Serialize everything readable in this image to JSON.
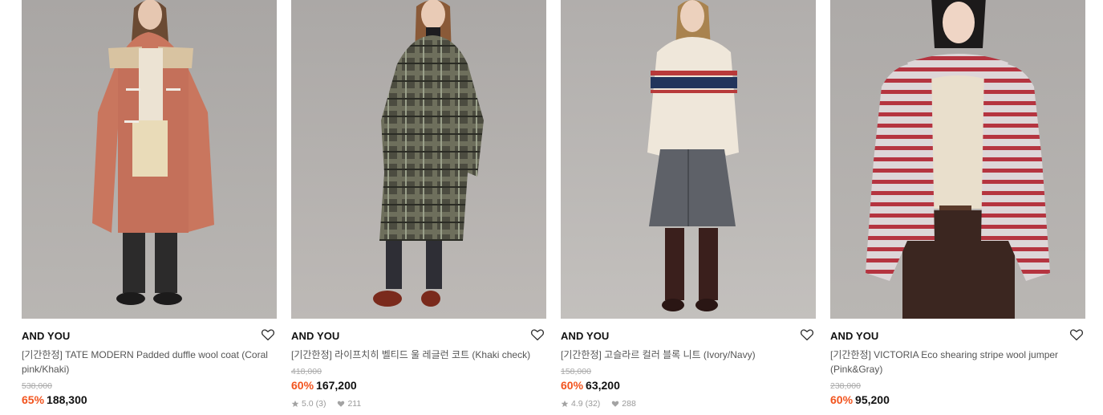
{
  "products": [
    {
      "brand": "AND YOU",
      "title": "[기간한정] TATE MODERN Padded duffle wool coat (Coral pink/Khaki)",
      "original_price": "538,000",
      "discount": "65%",
      "price": "188,300",
      "rating": "",
      "reviews": "",
      "likes": ""
    },
    {
      "brand": "AND YOU",
      "title": "[기간한정] 라이프치히 벨티드 울 레글런 코트 (Khaki check)",
      "original_price": "418,000",
      "discount": "60%",
      "price": "167,200",
      "rating": "5.0",
      "reviews": "(3)",
      "likes": "211"
    },
    {
      "brand": "AND YOU",
      "title": "[기간한정] 고슬라르 컬러 블록 니트 (Ivory/Navy)",
      "original_price": "158,000",
      "discount": "60%",
      "price": "63,200",
      "rating": "4.9",
      "reviews": "(32)",
      "likes": "288"
    },
    {
      "brand": "AND YOU",
      "title": "[기간한정] VICTORIA Eco shearing stripe wool jumper (Pink&Gray)",
      "original_price": "238,000",
      "discount": "60%",
      "price": "95,200",
      "rating": "",
      "reviews": "",
      "likes": ""
    }
  ],
  "colors": {
    "discount": "#f2541e",
    "price": "#111111",
    "brand": "#111111",
    "title": "#555555",
    "original_price": "#aaaaaa",
    "meta": "#999999",
    "photo_background": "#b7b3b0"
  },
  "icons": {
    "wishlist": "heart-outline-icon",
    "rating": "star-icon",
    "likes": "heart-filled-icon"
  }
}
